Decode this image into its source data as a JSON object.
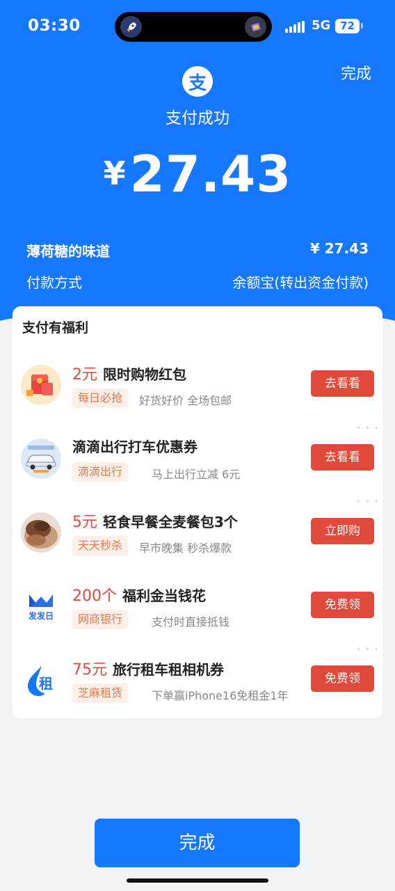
{
  "status_bar": {
    "time": "03:30",
    "network": "5G",
    "battery": "72"
  },
  "header": {
    "done_label": "完成",
    "success_text": "支付成功",
    "currency_symbol": "¥",
    "amount": "27.43",
    "merchant": "薄荷糖的味道",
    "merchant_amount": "¥ 27.43",
    "payment_method_label": "付款方式",
    "payment_method_value": "余额宝(转出资金付款)",
    "logo_char": "支"
  },
  "benefits": {
    "title": "支付有福利",
    "items": [
      {
        "price": "2元",
        "title": "限时购物红包",
        "tag": "每日必抢",
        "desc": "好货好价 全场包邮",
        "button": "去看看",
        "icon": "red-envelope-icon"
      },
      {
        "price": "",
        "title": "滴滴出行打车优惠券",
        "tag": "滴滴出行",
        "desc": "马上出行立减 6元",
        "button": "去看看",
        "icon": "car-icon"
      },
      {
        "price": "5元",
        "title": "轻食早餐全麦餐包3个",
        "tag": "天天秒杀",
        "desc": "早市晚集 秒杀爆款",
        "button": "立即购",
        "icon": "bread-icon"
      },
      {
        "price": "200个",
        "title": "福利金当钱花",
        "tag": "网商银行",
        "desc": "支付时直接抵钱",
        "button": "免费领",
        "icon": "bank-logo-icon",
        "icon_text": "发发日"
      },
      {
        "price": "75元",
        "title": "旅行租车租相机券",
        "tag": "芝麻租赁",
        "desc": "下单赢iPhone16免租金1年",
        "button": "免费领",
        "icon": "rental-logo-icon",
        "icon_text": "租"
      }
    ]
  },
  "footer": {
    "done_label": "完成"
  },
  "colors": {
    "primary": "#1677ff",
    "accent_red": "#e1493a",
    "tag_bg": "#fdeee8",
    "tag_text": "#e8784c"
  }
}
